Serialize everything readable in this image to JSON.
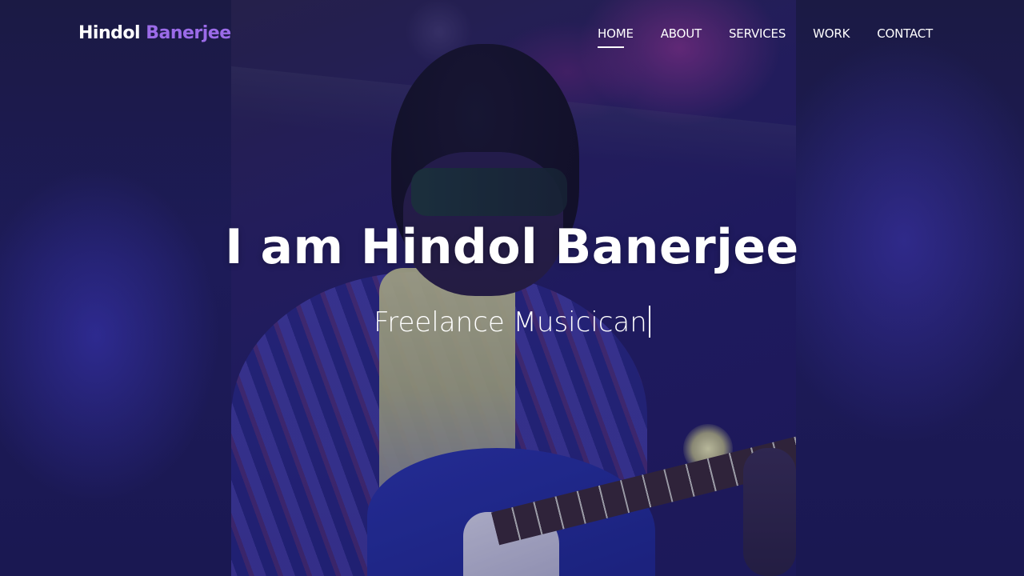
{
  "brand": {
    "first": "Hindol",
    "last": "Banerjee",
    "accent_color": "#9b6be8"
  },
  "nav": {
    "items": [
      {
        "label": "HOME",
        "active": true
      },
      {
        "label": "ABOUT",
        "active": false
      },
      {
        "label": "SERVICES",
        "active": false
      },
      {
        "label": "WORK",
        "active": false
      },
      {
        "label": "CONTACT",
        "active": false
      }
    ]
  },
  "hero": {
    "headline": "I am Hindol Banerjee",
    "typed_text": "Freelance Musicican",
    "background_color": "#1d1b58"
  }
}
